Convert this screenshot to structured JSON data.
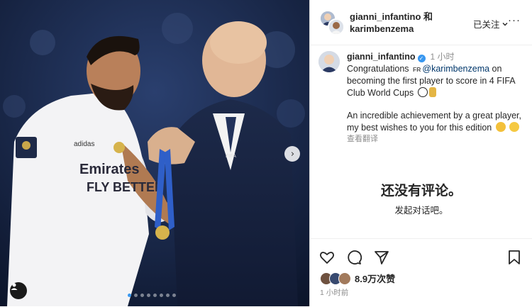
{
  "header": {
    "names_line1": "gianni_infantino 和",
    "names_line2": "karimbenzema",
    "follow_label": "已关注",
    "more_label": "···"
  },
  "caption": {
    "username": "gianni_infantino",
    "time": "1 小时",
    "text_before_mention": "Congratulations",
    "lang_tag": "FR",
    "mention": "@karimbenzema",
    "text_after_mention": " on becoming the first player to score in 4 FIFA Club World Cups",
    "paragraph2": "An incredible achievement by a great player, my best wishes to you for this edition",
    "translate_label": "查看翻译"
  },
  "comments": {
    "empty_title": "还没有评论。",
    "empty_subtitle": "发起对话吧。"
  },
  "footer": {
    "likes": "8.9万次赞",
    "post_time": "1 小时前"
  },
  "carousel": {
    "next_glyph": "›",
    "count": 8,
    "active_index": 0
  },
  "colors": {
    "accent": "#3897f0",
    "link": "#00376b",
    "muted": "#8e8e8e"
  },
  "icons": [
    "heart-icon",
    "comment-icon",
    "share-icon",
    "bookmark-icon",
    "verified-icon",
    "chevron-down-icon",
    "user-tag-icon",
    "next-arrow-icon"
  ]
}
